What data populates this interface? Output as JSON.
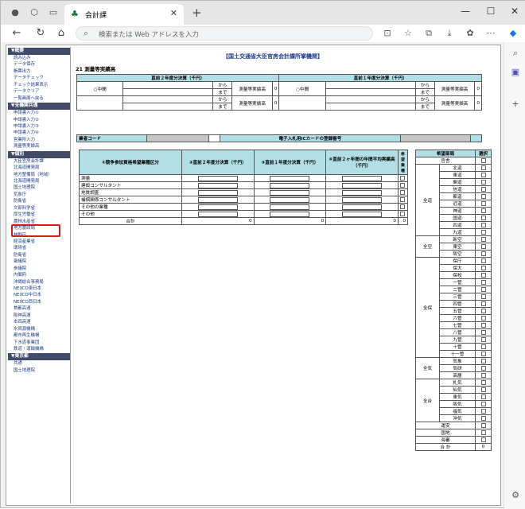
{
  "browser": {
    "tab_title": "会計課",
    "address_placeholder": "検索または Web アドレスを入力"
  },
  "page": {
    "title": "【国土交通省大臣官房会計課所掌機関】",
    "section": "21 測量等実績高"
  },
  "sidebar": {
    "groups": [
      {
        "header": "▼概要",
        "items": [
          "読み込み",
          "データ保存",
          "帳票出力",
          "データチェック",
          "チェック結果表示",
          "データクリア",
          "一覧画面へ戻る"
        ]
      },
      {
        "header": "▼全機関共通",
        "items": [
          "申請書入力①",
          "申請書入力②",
          "申請書入力③",
          "申請書入力④",
          "営業所入力",
          "測量等実績高"
        ]
      },
      {
        "header": "▼個別",
        "items": [
          "大臣官房会計課",
          "北海道開発局",
          "地方整備局（地域）",
          "北海道開発局",
          "国土地理院",
          "気象庁",
          "防衛省",
          "文部科学省",
          "厚生労働省",
          "農林水産省",
          "地方農政局",
          "林野庁",
          "経済産業省",
          "環境省",
          "防衛省",
          "衆議院",
          "参議院",
          "内閣府",
          "沖縄総合事務局",
          "NEXCO東日本",
          "NEXCO中日本",
          "NEXCO西日本",
          "首都高速",
          "阪神高速",
          "本四高速",
          "水資源機構",
          "都市再生機構",
          "下水道事業団",
          "鉄道・運輸機構"
        ]
      },
      {
        "header": "▼東京都",
        "items": [
          "共通",
          "国土地理院"
        ]
      }
    ]
  },
  "top_table": {
    "left_header": "直前２年度分決算（千円）",
    "right_header": "直前１年度分決算（千円）",
    "middle_label": "中間",
    "from": "から",
    "to": "まで",
    "amount_label": "測量等実績高",
    "zero": "0"
  },
  "reg": {
    "vendor_code": "業者コード",
    "ic_label": "電子入札用ICカードの登録番号"
  },
  "main_table": {
    "col1": "①競争参加資格希望業種区分",
    "col2": "②直前２年度分決算（千円）",
    "col3": "③直前１年度分決算（千円）",
    "col4": "④直前２ヶ年間の年間平均実績高（千円）",
    "col5": "希望業種",
    "rows": [
      "測量",
      "建設コンサルタント",
      "地質調査",
      "補償関係コンサルタント",
      "その他の業種",
      "その他"
    ],
    "total_label": "合計",
    "zero": "0"
  },
  "bureau_table": {
    "col1": "希望部局",
    "col2": "選択",
    "groups": [
      {
        "name": "",
        "items": [
          "官舎"
        ]
      },
      {
        "name": "全道",
        "items": [
          "北道",
          "東道",
          "関道",
          "信道",
          "都道",
          "近道",
          "神道",
          "国道",
          "四道",
          "九道"
        ]
      },
      {
        "name": "全空",
        "items": [
          "新空",
          "東空",
          "阪空"
        ]
      },
      {
        "name": "全保",
        "items": [
          "保庁",
          "保大",
          "保校",
          "一管",
          "二管",
          "三管",
          "四管",
          "五管",
          "六管",
          "七管",
          "八管",
          "九管",
          "十管",
          "十一管"
        ]
      },
      {
        "name": "全気",
        "items": [
          "気象",
          "気研",
          "高層"
        ]
      },
      {
        "name": "全台",
        "items": [
          "札気",
          "仙気",
          "東気",
          "阪気",
          "福気",
          "沖気"
        ]
      }
    ],
    "tail": [
      "運安",
      "国地",
      "海審"
    ],
    "total_label": "合 計",
    "total_value": "0"
  }
}
